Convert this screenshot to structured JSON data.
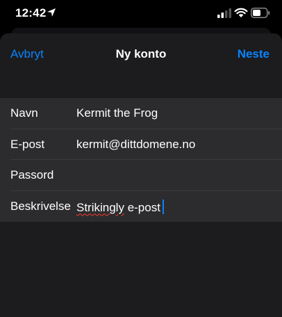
{
  "status_bar": {
    "time": "12:42",
    "icons": [
      "location-arrow-icon",
      "cellular-signal-icon",
      "wifi-icon",
      "battery-icon"
    ]
  },
  "nav": {
    "cancel_label": "Avbryt",
    "title": "Ny konto",
    "next_label": "Neste"
  },
  "form": {
    "rows": [
      {
        "label": "Navn",
        "value": "Kermit the Frog"
      },
      {
        "label": "E-post",
        "value": "kermit@dittdomene.no"
      },
      {
        "label": "Passord",
        "value": ""
      },
      {
        "label": "Beskrivelse",
        "value_word1": "Strikingly",
        "value_word2": " e-post"
      }
    ]
  },
  "colors": {
    "accent": "#0a84ff",
    "background": "#000000",
    "sheet": "#1c1c1e",
    "form_row": "#2c2c2e",
    "spellcheck": "#ff3b30"
  }
}
